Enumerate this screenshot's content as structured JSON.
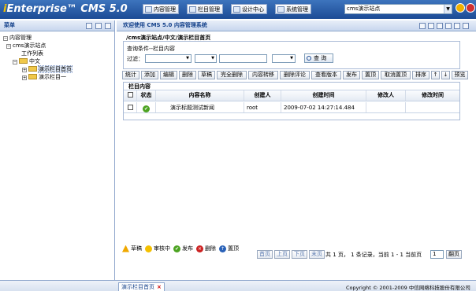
{
  "app": {
    "logo_prefix": "i",
    "logo_text": "Enterprise™ CMS 5.0"
  },
  "top_menu": [
    {
      "label": "内容管理",
      "icon": "content-icon"
    },
    {
      "label": "栏目管理",
      "icon": "column-icon"
    },
    {
      "label": "设计中心",
      "icon": "design-icon"
    },
    {
      "label": "系统管理",
      "icon": "system-icon"
    }
  ],
  "site_select": {
    "value": "cms演示站点"
  },
  "sidebar": {
    "title": "菜单",
    "tree": {
      "root": "内容管理",
      "site": "cms演示站点",
      "worklist": "工作列表",
      "lang": "中文",
      "item1": "演示栏目首页",
      "item2": "演示栏目一"
    }
  },
  "main": {
    "title": "欢迎使用 CMS 5.0 内容管理系统",
    "breadcrumb": "/cms演示站点/中文/演示栏目首页",
    "query": {
      "title": "查询条件--栏目内容",
      "filter_label": "过滤：",
      "search_label": "查 询"
    },
    "toolbar": [
      "统计",
      "添加",
      "编辑",
      "删除",
      "草稿",
      "完全删除",
      "内容转移",
      "删除评论",
      "查看版本",
      "发布",
      "置顶",
      "取消置顶",
      "排序",
      "↑",
      "↓",
      "预览"
    ],
    "grid": {
      "title": "栏目内容",
      "columns": [
        "状态",
        "内容名称",
        "创建人",
        "创建时间",
        "修改人",
        "修改时间"
      ],
      "rows": [
        {
          "name": "演示标题测试新闻",
          "creator": "root",
          "created": "2009-07-02 14:27:14.484",
          "modifier": "",
          "modified": ""
        }
      ]
    },
    "legend": [
      {
        "label": "草稿",
        "color": "#f0a800",
        "icon": "draft-icon"
      },
      {
        "label": "审核中",
        "color": "#f4c000",
        "icon": "review-icon"
      },
      {
        "label": "发布",
        "color": "#4ca321",
        "icon": "publish-icon"
      },
      {
        "label": "删除",
        "color": "#cc2222",
        "icon": "delete-icon"
      },
      {
        "label": "置顶",
        "color": "#2a62b8",
        "icon": "top-icon"
      }
    ],
    "pager": {
      "first": "首页",
      "prev": "上页",
      "next": "下页",
      "last": "末页",
      "info": "共 1 页， 1 条记录，当前 1 - 1 当前页",
      "page": "1",
      "go": "翻页"
    }
  },
  "bottom": {
    "tab": "演示栏目首页",
    "copyright": "Copyright © 2001-2009   中信网络科技股份有限公司"
  },
  "colors": {
    "header": "#1c4b95",
    "accent": "#15428b"
  }
}
